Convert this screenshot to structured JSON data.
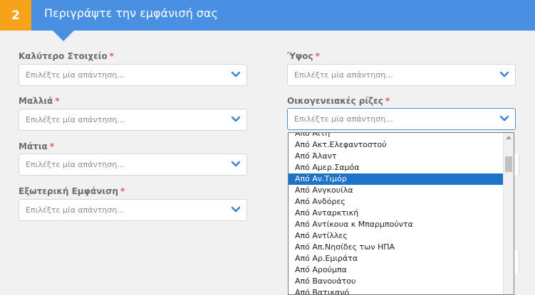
{
  "header": {
    "step_number": "2",
    "title": "Περιγράψτε την εμφάνισή σας"
  },
  "required_marker": "*",
  "fields": {
    "best_feature": {
      "label": "Καλύτερο Στοιχείο",
      "placeholder": "Επιλέξτε μία απάντηση..."
    },
    "height": {
      "label": "Ύψος",
      "placeholder": "Επιλέξτε μία απάντηση..."
    },
    "hair": {
      "label": "Μαλλιά",
      "placeholder": "Επιλέξτε μία απάντηση..."
    },
    "ancestry": {
      "label": "Οικογενειακές ρίζες",
      "placeholder": "Επιλέξτε μία απάντηση..."
    },
    "eyes": {
      "label": "Μάτια",
      "placeholder": "Επιλέξτε μία απάντηση..."
    },
    "appearance": {
      "label": "Εξωτερική Εμφάνιση",
      "placeholder": "Επιλέξτε μία απάντηση..."
    }
  },
  "dropdown": {
    "options": [
      "Από Αϊτή",
      "Από Ακτ.Ελεφαντοστού",
      "Από Άλαντ",
      "Από Αμερ.Σαμόα",
      "Από Αν.Τιμόρ",
      "Από Ανγκουίλα",
      "Από Ανδόρες",
      "Από Ανταρκτική",
      "Από Αντίκουα κ Μπαρμπούντα",
      "Από Αντίλλες",
      "Από Απ.Νησίδες των ΗΠΑ",
      "Από Αρ.Εμιράτα",
      "Από Αρούμπα",
      "Από Βανουάτου",
      "Από Βατικανό"
    ],
    "selected_index": 4
  },
  "colors": {
    "header": "#4a90e2",
    "badge": "#f7a21b",
    "required": "#e85a4f",
    "chevron": "#3b7fd4",
    "selected_option": "#1e72c8"
  }
}
